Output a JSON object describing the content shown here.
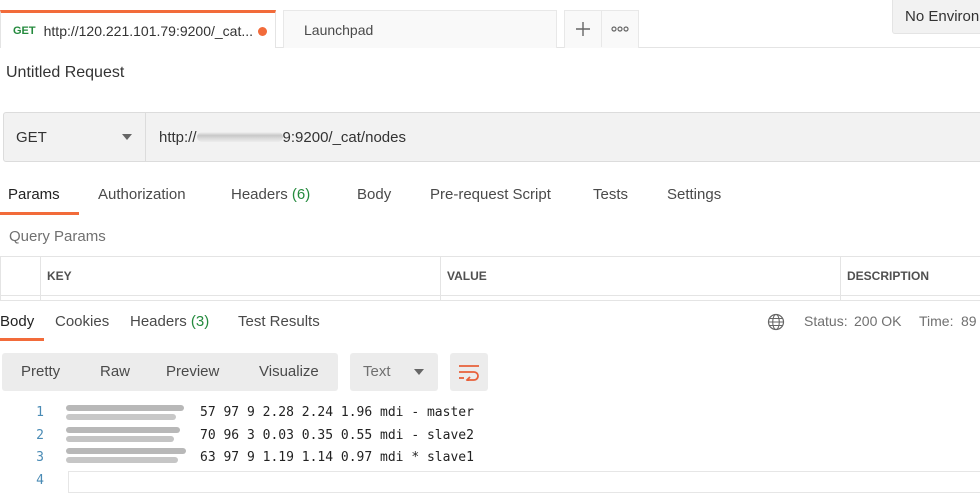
{
  "tabs": {
    "request_tab": {
      "method": "GET",
      "title": "http://120.221.101.79:9200/_cat..."
    },
    "launchpad": {
      "label": "Launchpad"
    },
    "add_icon": "plus-icon",
    "more_icon": "ellipsis-icon"
  },
  "environment": {
    "label": "No Environ"
  },
  "request": {
    "name": "Untitled Request",
    "method": "GET",
    "url_prefix": "http://",
    "url_suffix": "9:9200/_cat/nodes"
  },
  "request_tabs": [
    {
      "label": "Params",
      "active": true
    },
    {
      "label": "Authorization"
    },
    {
      "label": "Headers",
      "count": "(6)"
    },
    {
      "label": "Body"
    },
    {
      "label": "Pre-request Script"
    },
    {
      "label": "Tests"
    },
    {
      "label": "Settings"
    }
  ],
  "query_params": {
    "title": "Query Params",
    "columns": [
      "KEY",
      "VALUE",
      "DESCRIPTION"
    ]
  },
  "response": {
    "tabs": [
      {
        "label": "Body",
        "active": true
      },
      {
        "label": "Cookies"
      },
      {
        "label": "Headers",
        "count": "(3)"
      },
      {
        "label": "Test Results"
      }
    ],
    "status_label": "Status:",
    "status_value": "200 OK",
    "time_label": "Time:",
    "time_value": "89",
    "format_buttons": [
      "Pretty",
      "Raw",
      "Preview",
      "Visualize"
    ],
    "text_type": "Text",
    "lines": [
      {
        "n": "1",
        "text": "57 97 9 2.28 2.24 1.96 mdi - master"
      },
      {
        "n": "2",
        "text": "70 96 3 0.03 0.35 0.55 mdi - slave2"
      },
      {
        "n": "3",
        "text": "63 97 9 1.19 1.14 0.97 mdi * slave1"
      },
      {
        "n": "4",
        "text": ""
      }
    ]
  },
  "colors": {
    "accent": "#f26b3a",
    "success": "#248a3d",
    "line_number": "#4a8bb5"
  }
}
